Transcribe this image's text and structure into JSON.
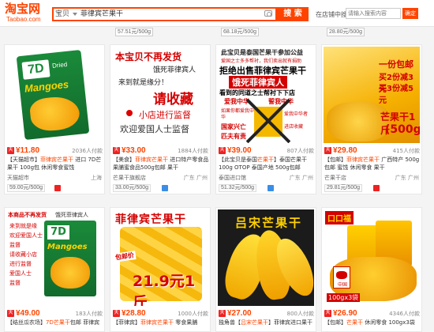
{
  "header": {
    "logo": "淘宝网",
    "logo_sub": "Taobao.com",
    "search_scope": "宝贝",
    "search_query": "菲律宾芒果干",
    "search_button": "搜 索",
    "shop_search_label": "在店铺中搜索",
    "shop_search_placeholder": "请输入搜索内容",
    "shop_search_button": "确定"
  },
  "remnant_row": [
    {
      "tag": "57.51元/500g"
    },
    {
      "tag": "68.18元/500g"
    },
    {
      "tag": "28.80元/500g"
    }
  ],
  "products": [
    {
      "price": "¥11.80",
      "pay_count": "2036人付款",
      "title_plain": "【天猫超市】",
      "title_hl": "菲律宾芒果干",
      "title_rest": " 进口 7D芒果干 100g包 休闲零食蜜饯",
      "shop": "天猫超市",
      "location": "上海",
      "unit_price": "59.00元/500g",
      "image": {
        "brand": "7D",
        "brand_sub": "Dried",
        "name": "Mangoes"
      }
    },
    {
      "price": "¥33.00",
      "pay_count": "1884人付款",
      "title_plain": "【美食】",
      "title_hl": "菲律宾芒果干",
      "title_rest": " 进口特产零食品果脯蜜食品500g包邮 果干",
      "shop": "芒果干旗舰店",
      "location": "广东 广州",
      "unit_price": "33.00元/500g",
      "image": {
        "l1": "本宝贝不再发货",
        "l2": "饿死菲律宾人",
        "l3": "来到就是缘分！",
        "l4": "请收藏",
        "l5": "小店进行监督",
        "l6": "欢迎爱国人士监督"
      }
    },
    {
      "price": "¥39.00",
      "pay_count": "807人付款",
      "title_plain": "【此宝贝是泰国",
      "title_hl": "芒果干",
      "title_rest": "】泰国芒果干 100g OTOP 泰国产地 500g包邮",
      "shop": "泰国进口馆",
      "location": "广东 广州",
      "unit_price": "51.32元/500g",
      "image": {
        "l1": "此宝贝是泰国芒果干参加公益",
        "l2": "爱国之士多多帮衬，我们卖出就有捐助",
        "l3": "拒绝出售菲律宾芒果干",
        "l4": "饿死菲律宾人",
        "l5": "看到的同道之士帮衬下下店",
        "l6": "爱我中华",
        "l7": "誓我中华",
        "l8": "如果你都爱我中华",
        "l9": "国家兴亡",
        "l10": "匹夫有责",
        "l11": "爱我中华者",
        "l12": "进店收藏"
      }
    },
    {
      "price": "¥29.80",
      "pay_count": "415人付款",
      "title_plain": "【包邮】",
      "title_hl": "菲律宾芒果干",
      "title_rest": " 广西特产 500g包邮 蜜饯 休闲零食 果干",
      "shop": "芒果干店",
      "location": "广东 广州",
      "unit_price": "29.81元/500g",
      "image": {
        "l1": "一份包邮",
        "l2": "买2份减3元",
        "l3": "买3份减5元",
        "l4": "芒果干1斤",
        "l5": "(500g)"
      }
    },
    {
      "price": "¥49.00",
      "pay_count": "183人付款",
      "title_plain": "【结丝瓜农场】",
      "title_hl": "7D芒果干",
      "title_rest": "包邮 菲律宾进口零食",
      "shop": "结丝瓜农场",
      "location": "广东 广州",
      "unit_price": "",
      "image": {
        "l1": "本商品不再发货",
        "l2": "饿死菲律宾人",
        "l3": "来到就是缘",
        "l4": "欢迎爱国人士",
        "l5": "监督",
        "l6": "请收藏小店",
        "l7": "进行监督",
        "l8": "爱国人士",
        "l9": "监督",
        "brand": "7D",
        "name": "Mangoes"
      }
    },
    {
      "price": "¥28.80",
      "pay_count": "1000人付款",
      "title_plain": "【菲律宾】",
      "title_hl": "菲律宾芒果干",
      "title_rest": " 零食果脯 500g包邮 休闲特产",
      "shop": "芒果干小铺",
      "location": "广东 广州",
      "unit_price": "",
      "image": {
        "l1": "菲律宾芒果干",
        "l2": "包邮价",
        "l3": "21.9元1斤"
      }
    },
    {
      "price": "¥27.00",
      "pay_count": "800人付款",
      "title_plain": "独角兽【",
      "title_hl": "吕宋芒果干",
      "title_rest": "】菲律宾进口果干 零食",
      "shop": "吕宋食品店",
      "location": "广东 广州",
      "unit_price": "",
      "image": {
        "l1": "吕宋芒果干"
      }
    },
    {
      "price": "¥26.90",
      "pay_count": "4346人付款",
      "title_plain": "【包邮】",
      "title_hl": "芒果干",
      "title_rest": " 休闲零食 100gx3袋 芒果",
      "shop": "口口福食品",
      "location": "广东 广州",
      "unit_price": "",
      "image": {
        "l1": "口口福",
        "l2": "100gx3袋",
        "l3": "中国"
      }
    }
  ],
  "colors": {
    "accent": "#ff4400",
    "mango": "#f5b800",
    "red_text": "#d40000"
  }
}
